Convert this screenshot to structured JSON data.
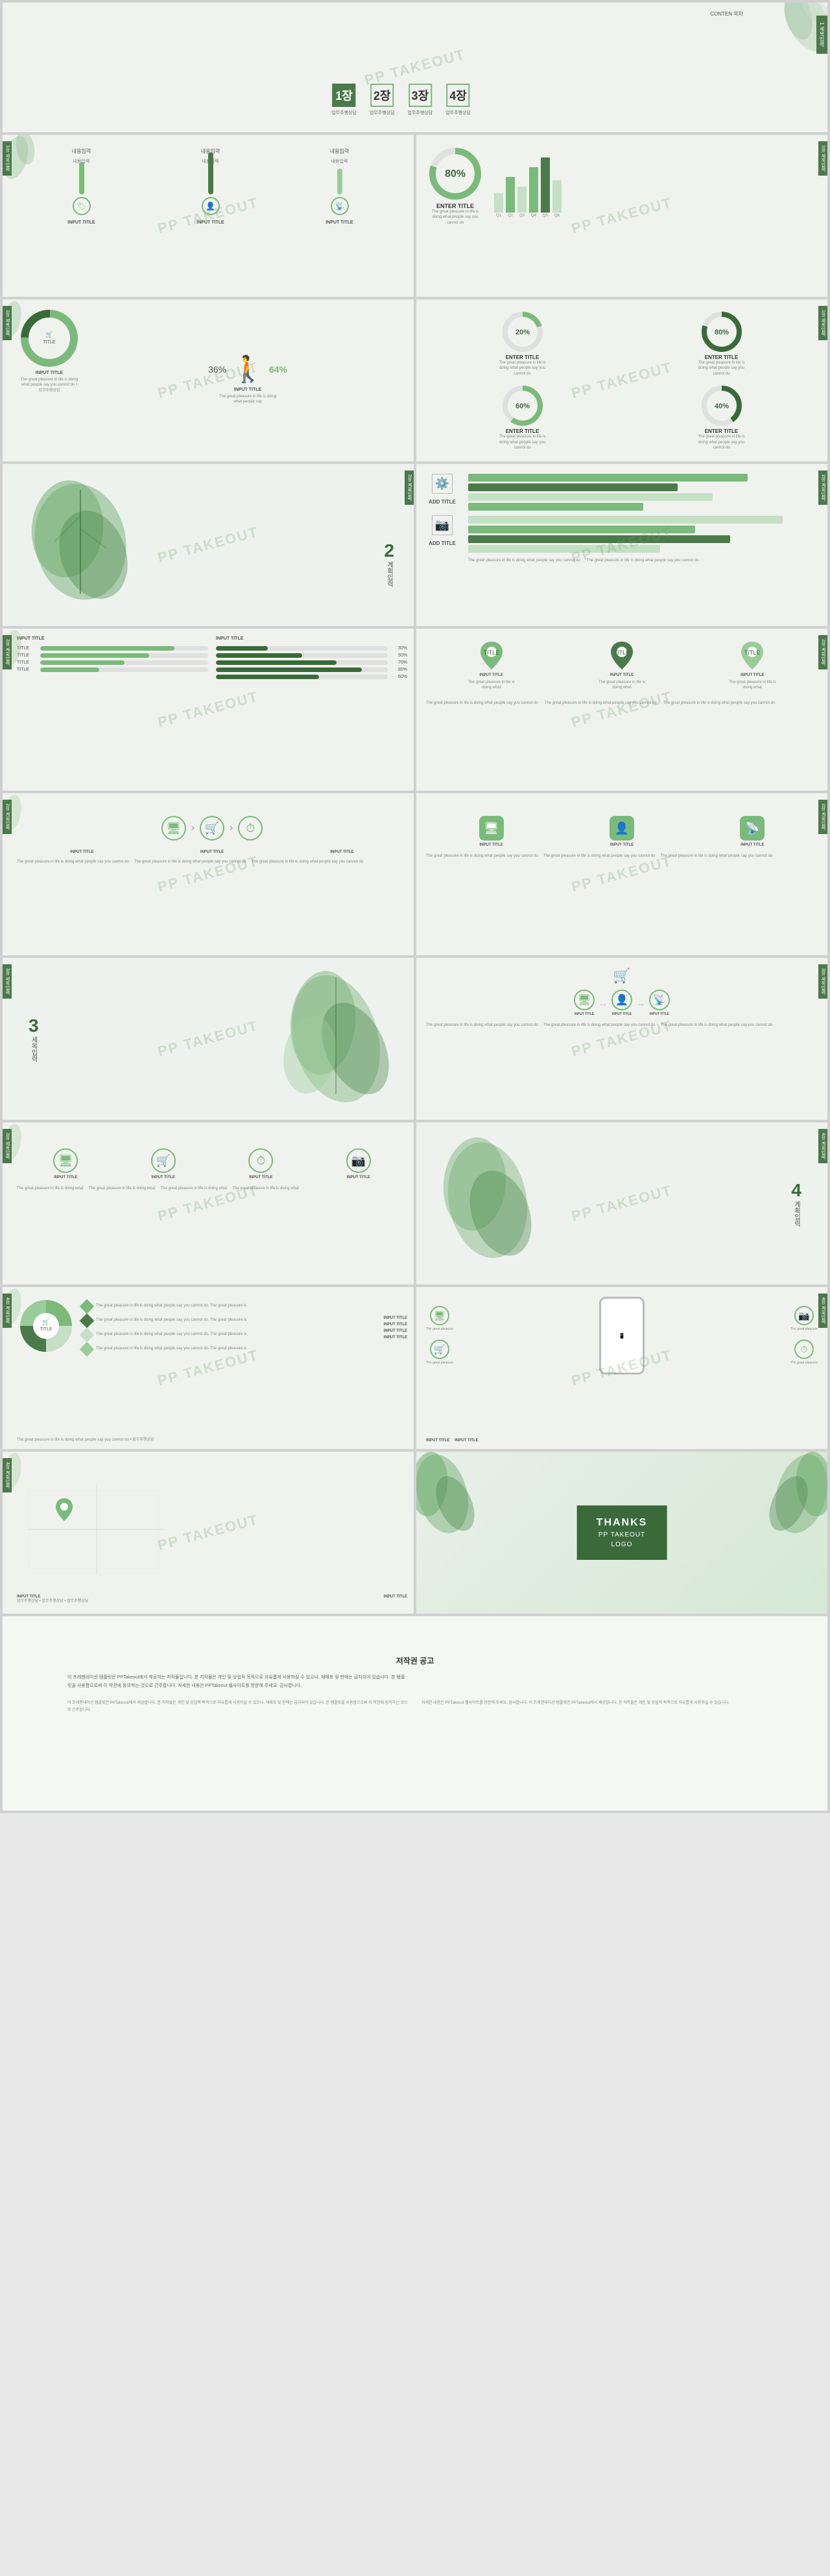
{
  "slides": {
    "cover": {
      "content_label": "CONTEN\n목차",
      "chapter1": "1장",
      "chapter1_sub": "업무주행상담",
      "chapter2": "2장",
      "chapter2_sub": "업무주행상담",
      "chapter3": "3장",
      "chapter3_sub": "업무주행상담",
      "chapter4": "4장",
      "chapter4_sub": "업무주행상담",
      "chapter_right": "1\n세목입력"
    },
    "watermark": "PP TAKEOUT",
    "input_title": "INPUT TITLE",
    "enter_title": "ENTER TITLE",
    "add_title": "ADD TITLE",
    "title_label": "Title",
    "title_input": "INPUT TITLe",
    "pct80": "80%",
    "pct20": "20%",
    "pct60": "60%",
    "pct40": "40%",
    "pct80b": "80%",
    "pct36": "36%",
    "pct64": "64%",
    "pct30": "30%",
    "pct50": "50%",
    "pct70": "70%",
    "thanks": {
      "line1": "THANKS",
      "line2": "PP TAKEOUT",
      "line3": "LOGO"
    },
    "chapter_labels": {
      "c1": "1장",
      "c2": "2장",
      "c3": "3장",
      "c4": "4장",
      "sub1": "세목입력",
      "sub2": "계획입력",
      "sub3": "세목입력",
      "sub4": "계획입력"
    },
    "footer_text": {
      "title": "저작권 공고",
      "body": "이 프레젠테이션 템플릿은 PPTakeout에서 제공하는 저작물입니다. 본 저작물은 개인 및 상업적 목적으로 자유롭게 사용하실 수 있으나, 재배포 및 판매는 금지되어 있습니다. 본 템플릿을 사용함으로써 이 약관에 동의하는 것으로 간주합니다. 자세한 내용은 PPTakeout 웹사이트를 방문해 주세요. 감사합니다."
    }
  }
}
